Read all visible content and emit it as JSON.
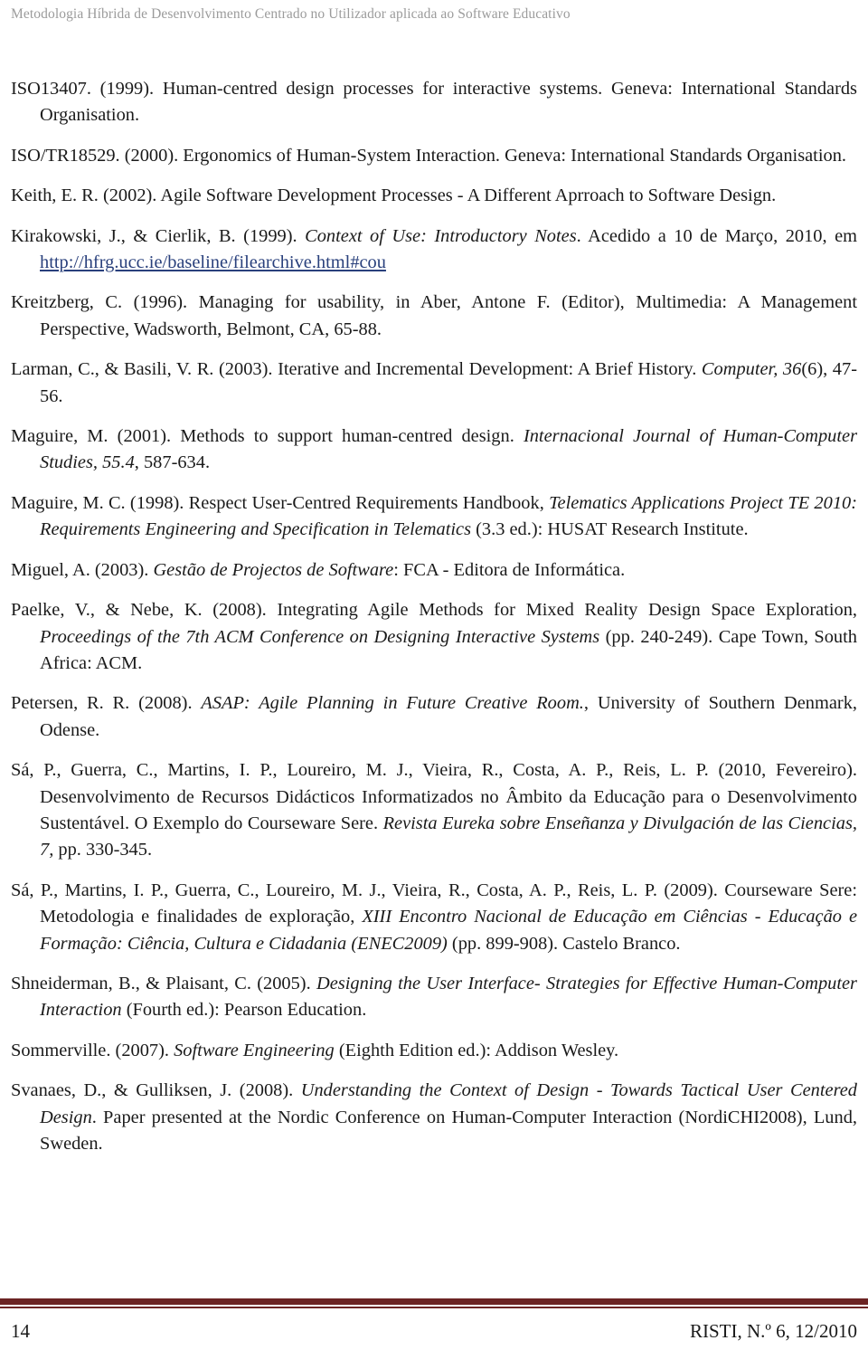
{
  "header": {
    "running_title": "Metodologia Híbrida de Desenvolvimento Centrado no Utilizador aplicada ao Software Educativo"
  },
  "colors": {
    "header_text": "#9b9b9b",
    "body_text": "#1a1a1a",
    "link": "#29407c",
    "footer_rule": "#6b2424",
    "page_background": "#ffffff"
  },
  "references": [
    {
      "id": "iso13407",
      "segments": [
        {
          "text": "ISO13407. (1999). Human-centred design processes for interactive systems. Geneva: International Standards Organisation.",
          "style": "normal"
        }
      ]
    },
    {
      "id": "iso-tr18529",
      "segments": [
        {
          "text": "ISO/TR18529. (2000). Ergonomics of Human-System Interaction. Geneva: International Standards Organisation.",
          "style": "normal"
        }
      ]
    },
    {
      "id": "keith-2002",
      "segments": [
        {
          "text": "Keith, E. R. (2002). Agile Software Development Processes - A Different Aprroach to Software Design.",
          "style": "normal"
        }
      ]
    },
    {
      "id": "kirakowski-1999",
      "segments": [
        {
          "text": "Kirakowski, J., & Cierlik, B. (1999). ",
          "style": "normal"
        },
        {
          "text": "Context of Use: Introductory Notes",
          "style": "italic"
        },
        {
          "text": ". Acedido a 10 de Março, 2010, em ",
          "style": "normal"
        },
        {
          "text": "http://hfrg.ucc.ie/baseline/filearchive.html#cou",
          "style": "link"
        }
      ]
    },
    {
      "id": "kreitzberg-1996",
      "segments": [
        {
          "text": "Kreitzberg, C. (1996). Managing for usability, in Aber, Antone F. (Editor), Multimedia: A Management Perspective, Wadsworth, Belmont, CA, 65-88.",
          "style": "normal"
        }
      ]
    },
    {
      "id": "larman-basili-2003",
      "segments": [
        {
          "text": "Larman, C., & Basili, V. R. (2003). Iterative and Incremental Development: A Brief History. ",
          "style": "normal"
        },
        {
          "text": "Computer, 36",
          "style": "italic"
        },
        {
          "text": "(6), 47-56.",
          "style": "normal"
        }
      ]
    },
    {
      "id": "maguire-2001",
      "segments": [
        {
          "text": "Maguire, M. (2001). Methods to support human-centred design. ",
          "style": "normal"
        },
        {
          "text": "Internacional Journal of Human-Computer Studies, 55.4",
          "style": "italic"
        },
        {
          "text": ", 587-634.",
          "style": "normal"
        }
      ]
    },
    {
      "id": "maguire-1998",
      "segments": [
        {
          "text": "Maguire, M. C. (1998). Respect User-Centred Requirements Handbook, ",
          "style": "normal"
        },
        {
          "text": "Telematics Applications Project TE 2010: Requirements Engineering and Specification in Telematics",
          "style": "italic"
        },
        {
          "text": " (3.3 ed.): HUSAT Research Institute.",
          "style": "normal"
        }
      ]
    },
    {
      "id": "miguel-2003",
      "segments": [
        {
          "text": "Miguel, A. (2003). ",
          "style": "normal"
        },
        {
          "text": "Gestão de Projectos de Software",
          "style": "italic"
        },
        {
          "text": ": FCA - Editora de Informática.",
          "style": "normal"
        }
      ]
    },
    {
      "id": "paelke-nebe-2008",
      "segments": [
        {
          "text": "Paelke, V., & Nebe, K. (2008). Integrating Agile Methods for Mixed Reality Design Space Exploration, ",
          "style": "normal"
        },
        {
          "text": "Proceedings of the 7th ACM Conference on Designing Interactive Systems",
          "style": "italic"
        },
        {
          "text": " (pp. 240-249). Cape Town, South Africa: ACM.",
          "style": "normal"
        }
      ]
    },
    {
      "id": "petersen-2008",
      "segments": [
        {
          "text": "Petersen, R. R. (2008). ",
          "style": "normal"
        },
        {
          "text": "ASAP: Agile Planning in Future Creative Room.",
          "style": "italic"
        },
        {
          "text": ", University of Southern Denmark, Odense.",
          "style": "normal"
        }
      ]
    },
    {
      "id": "sa-2010",
      "segments": [
        {
          "text": "Sá, P., Guerra, C., Martins, I. P., Loureiro, M. J., Vieira, R., Costa, A. P., Reis, L. P. (2010, Fevereiro). Desenvolvimento de Recursos Didácticos Informatizados no Âmbito da Educação para o Desenvolvimento Sustentável. O Exemplo do Courseware Sere. ",
          "style": "normal"
        },
        {
          "text": "Revista Eureka sobre Enseñanza y Divulgación de las Ciencias, 7,",
          "style": "italic"
        },
        {
          "text": " pp. 330-345.",
          "style": "normal"
        }
      ]
    },
    {
      "id": "sa-2009",
      "segments": [
        {
          "text": "Sá, P., Martins, I. P., Guerra, C., Loureiro, M. J., Vieira, R., Costa, A. P., Reis, L. P. (2009). Courseware Sere: Metodologia e finalidades de exploração, ",
          "style": "normal"
        },
        {
          "text": "XIII Encontro Nacional de Educação em Ciências - Educação e Formação: Ciência, Cultura e Cidadania (ENEC2009)",
          "style": "italic"
        },
        {
          "text": " (pp. 899-908). Castelo Branco.",
          "style": "normal"
        }
      ]
    },
    {
      "id": "shneiderman-plaisant-2005",
      "segments": [
        {
          "text": "Shneiderman, B., & Plaisant, C. (2005). ",
          "style": "normal"
        },
        {
          "text": "Designing the User Interface- Strategies for Effective Human-Computer Interaction",
          "style": "italic"
        },
        {
          "text": " (Fourth ed.): Pearson Education.",
          "style": "normal"
        }
      ]
    },
    {
      "id": "sommerville-2007",
      "segments": [
        {
          "text": "Sommerville. (2007). ",
          "style": "normal"
        },
        {
          "text": "Software Engineering",
          "style": "italic"
        },
        {
          "text": " (Eighth Edition ed.): Addison Wesley.",
          "style": "normal"
        }
      ]
    },
    {
      "id": "svanaes-gulliksen-2008",
      "segments": [
        {
          "text": "Svanaes, D., & Gulliksen, J. (2008). ",
          "style": "normal"
        },
        {
          "text": "Understanding the Context of Design - Towards Tactical User Centered Design",
          "style": "italic"
        },
        {
          "text": ". Paper presented at the Nordic Conference on Human-Computer Interaction (NordiCHI2008), Lund, Sweden.",
          "style": "normal"
        }
      ]
    }
  ],
  "footer": {
    "page_number": "14",
    "journal_reference": "RISTI, N.º 6, 12/2010"
  }
}
